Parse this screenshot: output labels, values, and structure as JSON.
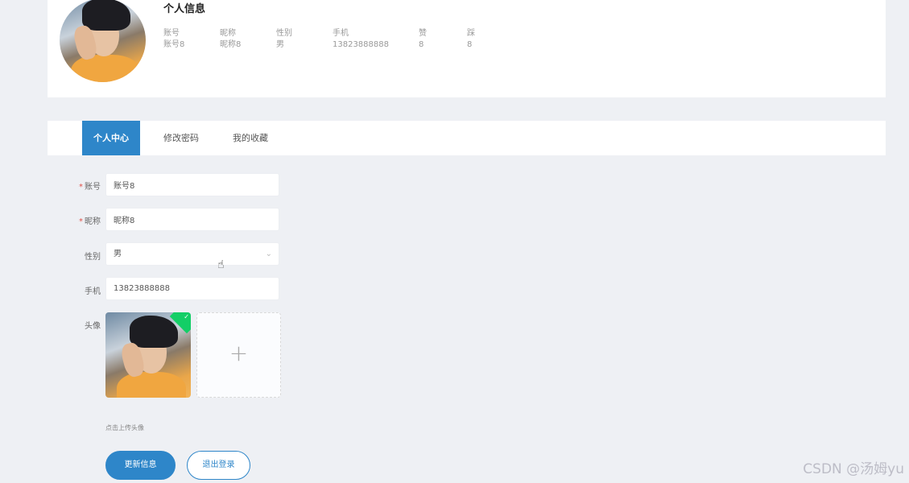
{
  "profile": {
    "title": "个人信息",
    "stats": [
      {
        "label": "账号",
        "value": "账号8"
      },
      {
        "label": "昵称",
        "value": "昵称8"
      },
      {
        "label": "性别",
        "value": "男"
      },
      {
        "label": "手机",
        "value": "13823888888"
      },
      {
        "label": "赞",
        "value": "8"
      },
      {
        "label": "踩",
        "value": "8"
      }
    ]
  },
  "tabs": [
    {
      "label": "个人中心",
      "active": true
    },
    {
      "label": "修改密码",
      "active": false
    },
    {
      "label": "我的收藏",
      "active": false
    }
  ],
  "form": {
    "account": {
      "label": "账号",
      "required": "*",
      "value": "账号8"
    },
    "nickname": {
      "label": "昵称",
      "required": "*",
      "value": "昵称8"
    },
    "gender": {
      "label": "性别",
      "value": "男"
    },
    "phone": {
      "label": "手机",
      "value": "13823888888"
    },
    "avatar": {
      "label": "头像",
      "add_symbol": "+",
      "hint": "点击上传头像"
    }
  },
  "buttons": {
    "update": "更新信息",
    "logout": "退出登录"
  },
  "colors": {
    "accent": "#2e86c9",
    "success": "#13ce66",
    "required": "#e0524b"
  },
  "icons": {
    "select": "chevron-down-icon",
    "upload_add": "plus-icon",
    "upload_ok": "check-icon",
    "cursor": "hand-pointer-icon"
  },
  "watermark": "CSDN @汤姆yu"
}
